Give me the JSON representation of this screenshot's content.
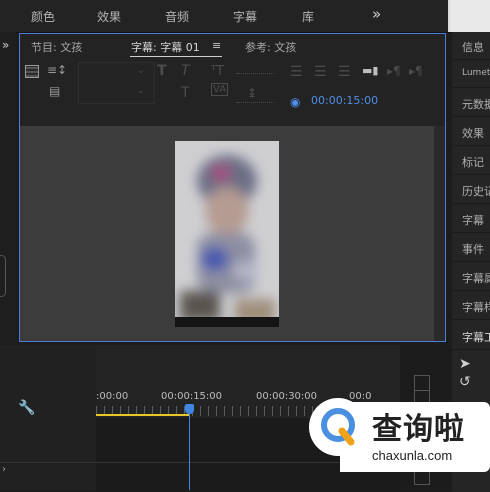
{
  "workspace_tabs": [
    "颜色",
    "效果",
    "音频",
    "字幕",
    "库"
  ],
  "workspace_more": "»",
  "panel": {
    "tabs": [
      "节目: 文孩",
      "字幕: 字幕 01",
      "参考: 文孩"
    ],
    "tab_menu": "≡",
    "timecode": "00:00:15:00"
  },
  "right_panels": [
    "信息",
    "Lumetri",
    "元数据",
    "效果",
    "标记",
    "历史记录",
    "字幕",
    "事件",
    "字幕属性",
    "字幕样式",
    "字幕工具"
  ],
  "timeline": {
    "ruler_labels": [
      ":00:00",
      "00:00:15:00",
      "00:00:30:00",
      "00:0"
    ]
  },
  "watermark": {
    "title": "查询啦",
    "url": "chaxunla.com",
    "accent": "#4a8fe0"
  },
  "colors": {
    "selection_border": "#4a7fd8",
    "timecode": "#4f8ee6",
    "playhead": "#3f86e4",
    "in_out_bar": "#e5c627"
  }
}
